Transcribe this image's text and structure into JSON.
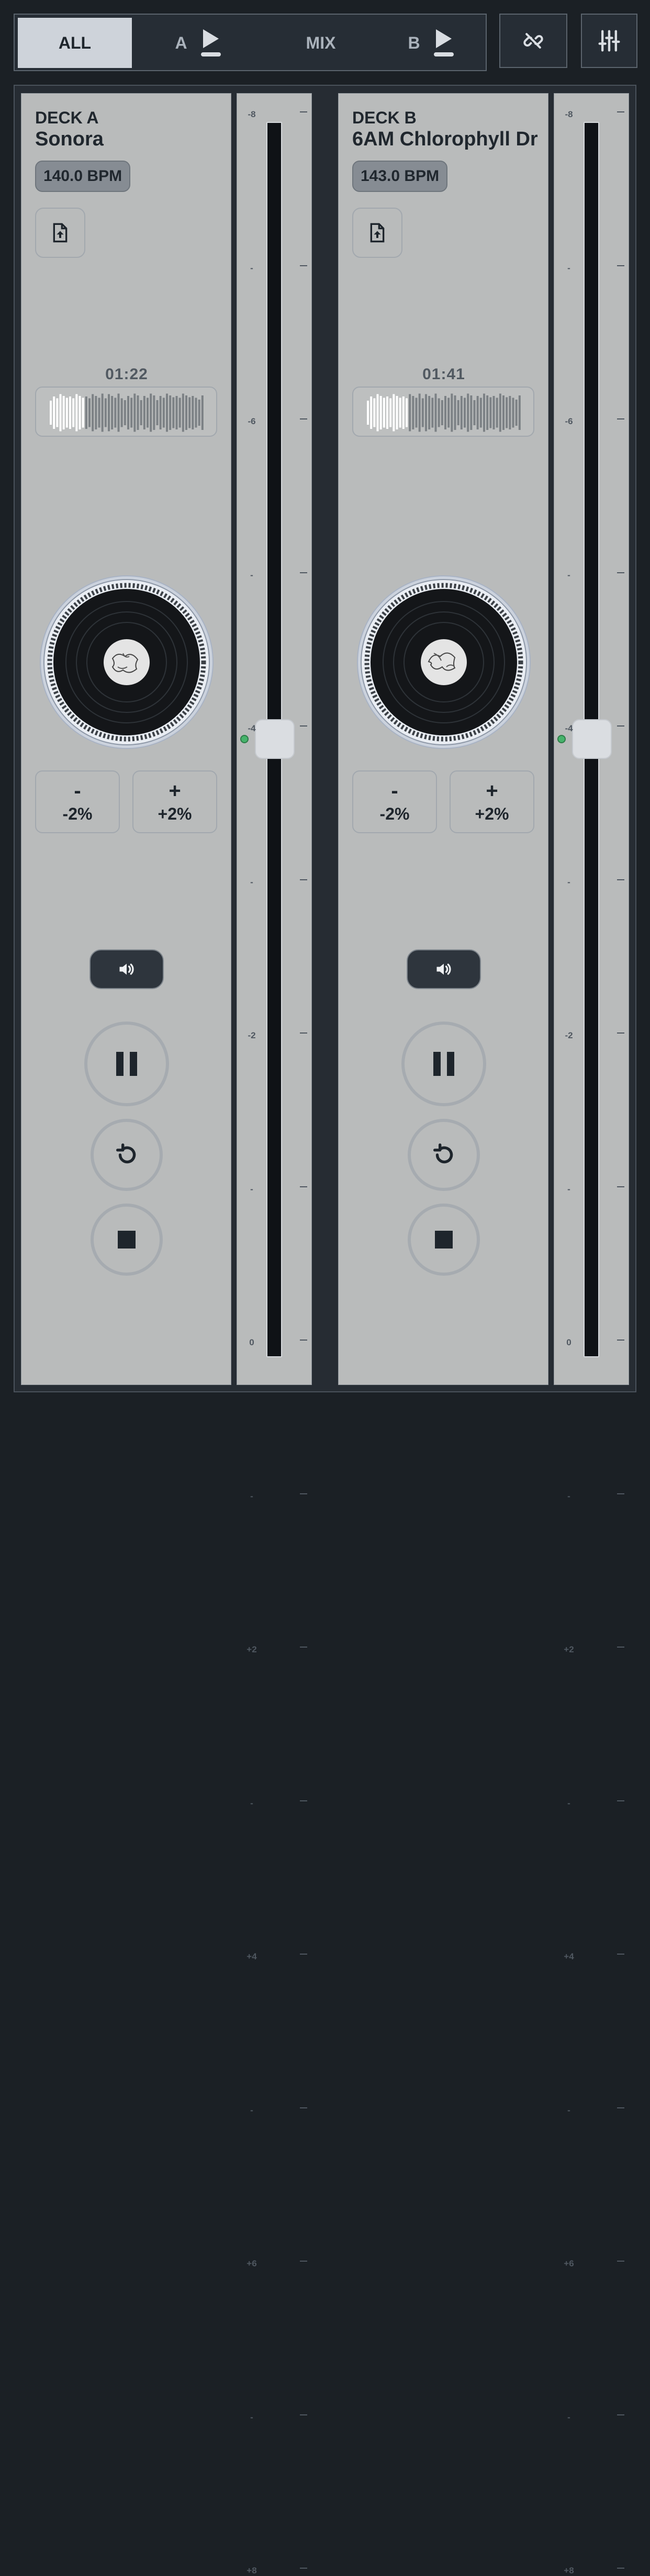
{
  "tabs": [
    {
      "label": "ALL",
      "active": true
    },
    {
      "label": "A",
      "icon": "play-icon"
    },
    {
      "label": "MIX"
    },
    {
      "label": "B",
      "icon": "play-icon"
    }
  ],
  "top_buttons": [
    {
      "name": "unlink-button",
      "icon": "unlink-icon"
    },
    {
      "name": "mixer-settings-button",
      "icon": "sliders-icon"
    }
  ],
  "decks": [
    {
      "label": "DECK A",
      "title": "Sonora",
      "bpm": "140.0 BPM",
      "time": "01:22",
      "progress": 0.22,
      "pitch_down": {
        "symbol": "-",
        "label": "-2%"
      },
      "pitch_up": {
        "symbol": "+",
        "label": "+2%"
      },
      "pitch_value": 0
    },
    {
      "label": "DECK B",
      "title": "6AM Chlorophyll Dr",
      "bpm": "143.0 BPM",
      "time": "01:41",
      "progress": 0.27,
      "pitch_down": {
        "symbol": "-",
        "label": "-2%"
      },
      "pitch_up": {
        "symbol": "+",
        "label": "+2%"
      },
      "pitch_value": 0
    }
  ],
  "pitch_scale": [
    "-8",
    "-",
    "-6",
    "-",
    "-4",
    "-",
    "-2",
    "-",
    "0",
    "-",
    "+2",
    "-",
    "+4",
    "-",
    "+6",
    "-",
    "+8"
  ],
  "colors": {
    "background": "#1b2025",
    "deck_panel": "#b9bbbb",
    "active_tab": "#ced3da",
    "fader_track": "#0f1216",
    "center_indicator": "#46b36b"
  }
}
